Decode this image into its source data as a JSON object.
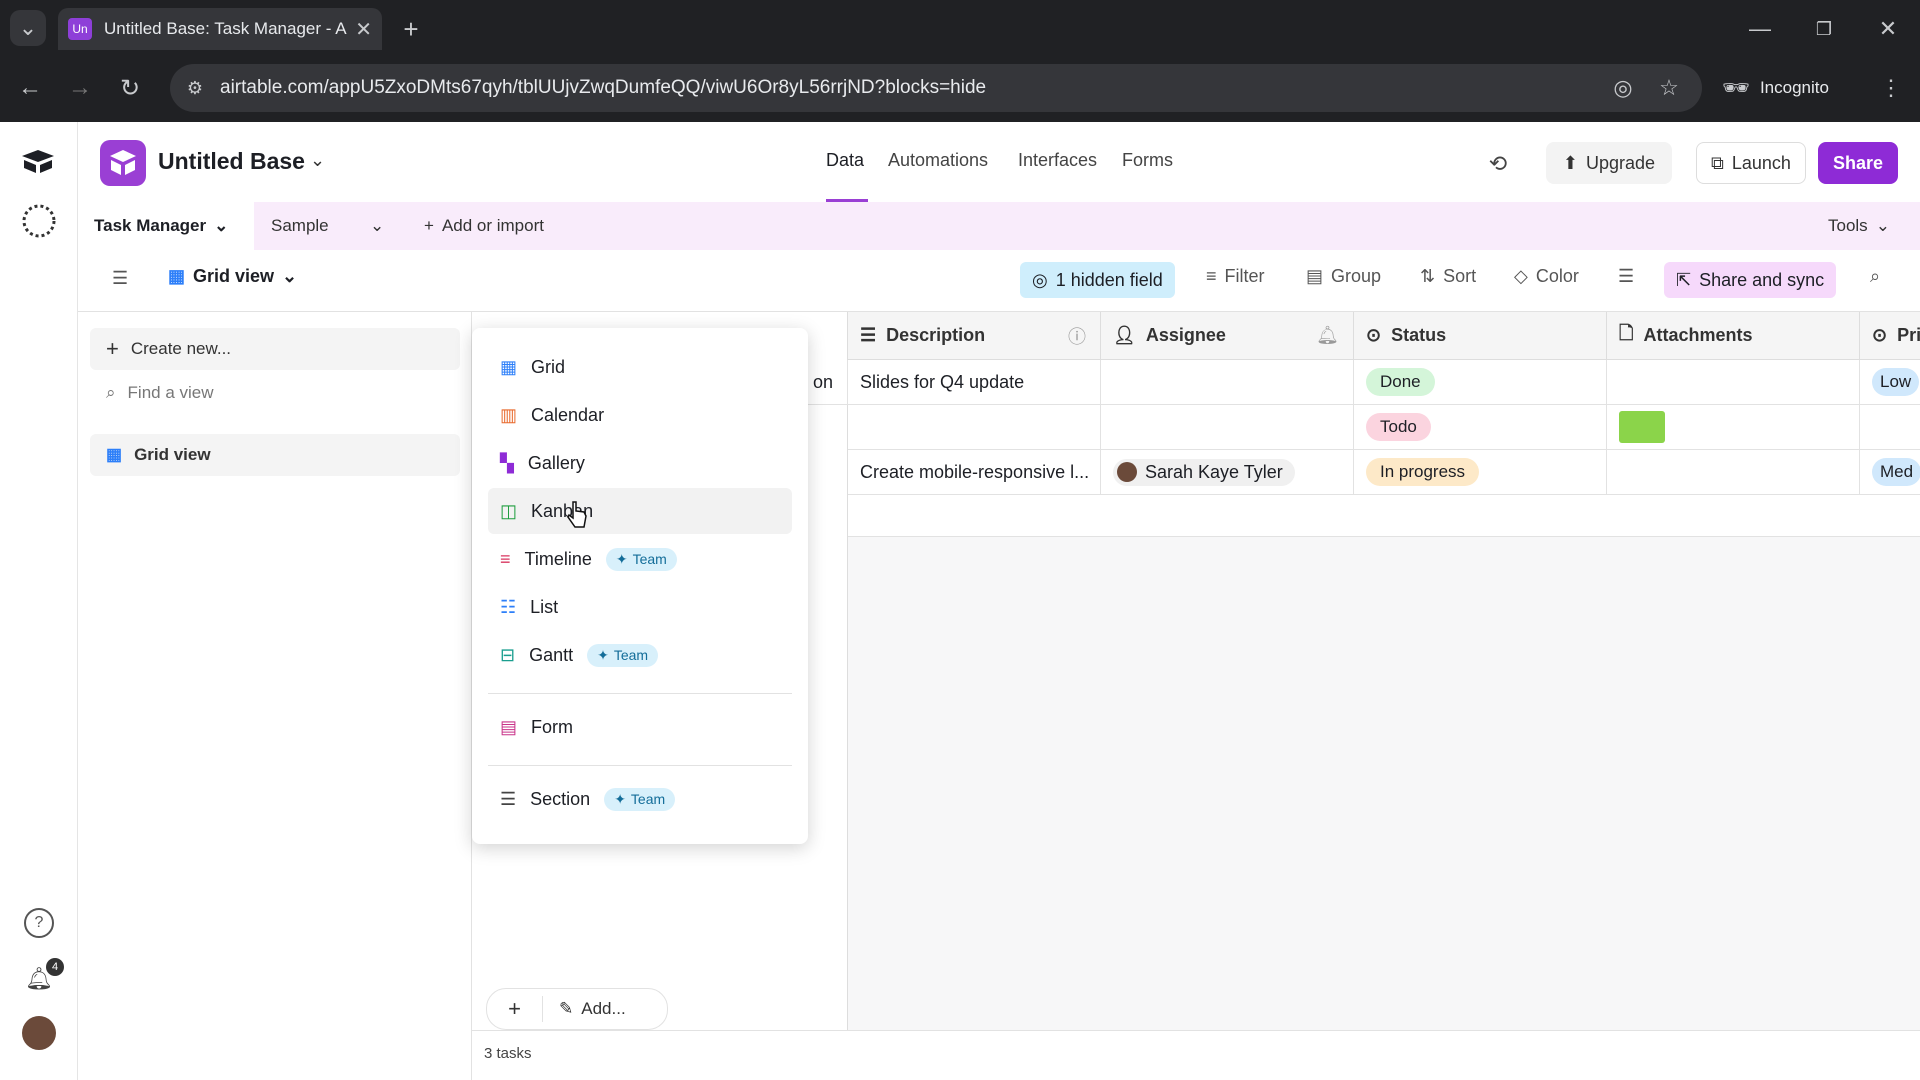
{
  "browser": {
    "tab_title": "Untitled Base: Task Manager - A",
    "tab_favicon": "Un",
    "url": "airtable.com/appU5ZxoDMts67qyh/tblUUjvZwqDumfeQQ/viwU6Or8yL56rrjND?blocks=hide",
    "incognito_label": "Incognito"
  },
  "header": {
    "base_name": "Untitled Base",
    "nav": [
      "Data",
      "Automations",
      "Interfaces",
      "Forms"
    ],
    "upgrade": "Upgrade",
    "launch": "Launch",
    "share": "Share"
  },
  "tablebar": {
    "table": "Task Manager",
    "sample": "Sample",
    "add": "Add or import",
    "tools": "Tools"
  },
  "toolbar": {
    "view": "Grid view",
    "hidden": "1 hidden field",
    "filter": "Filter",
    "group": "Group",
    "sort": "Sort",
    "color": "Color",
    "share_sync": "Share and sync"
  },
  "viewside": {
    "create": "Create new...",
    "find_placeholder": "Find a view",
    "current": "Grid view"
  },
  "menu": {
    "items": [
      {
        "label": "Grid",
        "icon": "grid-icon"
      },
      {
        "label": "Calendar",
        "icon": "calendar-icon"
      },
      {
        "label": "Gallery",
        "icon": "gallery-icon"
      },
      {
        "label": "Kanban",
        "icon": "kanban-icon"
      },
      {
        "label": "Timeline",
        "icon": "timeline-icon",
        "badge": "Team"
      },
      {
        "label": "List",
        "icon": "list-icon"
      },
      {
        "label": "Gantt",
        "icon": "gantt-icon",
        "badge": "Team"
      },
      {
        "label": "Form",
        "icon": "form-icon"
      },
      {
        "label": "Section",
        "icon": "section-icon",
        "badge": "Team"
      }
    ]
  },
  "grid": {
    "columns": [
      "Description",
      "Assignee",
      "Status",
      "Attachments",
      "Pri"
    ],
    "rows": [
      {
        "name_tail": "on",
        "description": "Slides for Q4 update",
        "assignee": "",
        "status": "Done",
        "priority": "Low"
      },
      {
        "name_tail": "",
        "description": "",
        "assignee": "",
        "status": "Todo",
        "priority": ""
      },
      {
        "name_tail": "",
        "description": "Create mobile-responsive l...",
        "assignee": "Sarah Kaye Tyler",
        "status": "In progress",
        "priority": "Med"
      }
    ],
    "footer_count": "3 tasks",
    "add_label": "Add..."
  },
  "notifications_count": "4",
  "colors": {
    "accent": "#8e2bd6",
    "done": "#d4f5d9",
    "todo": "#fbd4df",
    "in_progress": "#fde9c8",
    "team": "#d8f0fb"
  }
}
